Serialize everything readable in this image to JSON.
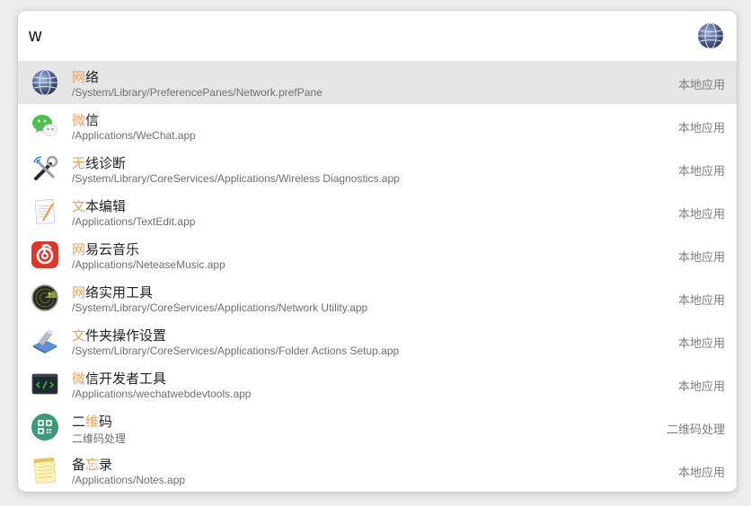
{
  "search": {
    "query": "w",
    "icon": "globe-icon"
  },
  "results": [
    {
      "title_hl": "网",
      "title_rest": "络",
      "path": "/System/Library/PreferencePanes/Network.prefPane",
      "kind": "本地应用",
      "icon": "network-globe-icon",
      "selected": true
    },
    {
      "title_hl": "微",
      "title_rest": "信",
      "path": "/Applications/WeChat.app",
      "kind": "本地应用",
      "icon": "wechat-icon"
    },
    {
      "title_hl": "无",
      "title_rest": "线诊断",
      "path": "/System/Library/CoreServices/Applications/Wireless Diagnostics.app",
      "kind": "本地应用",
      "icon": "wireless-diagnostics-icon"
    },
    {
      "title_hl": "文",
      "title_rest": "本编辑",
      "path": "/Applications/TextEdit.app",
      "kind": "本地应用",
      "icon": "textedit-icon"
    },
    {
      "title_hl": "网",
      "title_rest": "易云音乐",
      "path": "/Applications/NeteaseMusic.app",
      "kind": "本地应用",
      "icon": "netease-music-icon"
    },
    {
      "title_hl": "网",
      "title_rest": "络实用工具",
      "path": "/System/Library/CoreServices/Applications/Network Utility.app",
      "kind": "本地应用",
      "icon": "network-utility-icon"
    },
    {
      "title_hl": "文",
      "title_rest": "件夹操作设置",
      "path": "/System/Library/CoreServices/Applications/Folder Actions Setup.app",
      "kind": "本地应用",
      "icon": "folder-actions-icon"
    },
    {
      "title_hl": "微",
      "title_rest": "信开发者工具",
      "path": "/Applications/wechatwebdevtools.app",
      "kind": "本地应用",
      "icon": "wechat-devtools-icon"
    },
    {
      "title_pre": "二",
      "title_hl": "维",
      "title_rest": "码",
      "path": "二维码处理",
      "kind": "二维码处理",
      "icon": "qr-code-icon"
    },
    {
      "title_pre": "备",
      "title_hl": "忘",
      "title_rest": "录",
      "path": "/Applications/Notes.app",
      "kind": "本地应用",
      "icon": "notes-icon"
    }
  ]
}
